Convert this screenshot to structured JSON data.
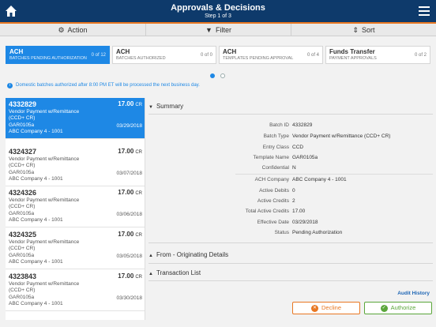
{
  "header": {
    "title": "Approvals & Decisions",
    "subtitle": "Step 1 of 3"
  },
  "toolbar": {
    "action": "Action",
    "filter": "Filter",
    "sort": "Sort"
  },
  "tiles": [
    {
      "title": "ACH",
      "subtitle": "BATCHES PENDING AUTHORIZATION",
      "count": "0 of 12"
    },
    {
      "title": "ACH",
      "subtitle": "BATCHES AUTHORIZED",
      "count": "0 of 0"
    },
    {
      "title": "ACH",
      "subtitle": "TEMPLATES PENDING APPROVAL",
      "count": "0 of 4"
    },
    {
      "title": "Funds Transfer",
      "subtitle": "PAYMENT APPROVALS",
      "count": "0 of 2"
    }
  ],
  "notice": "Domestic batches authorized after 8:00 PM ET will be processed the next business day.",
  "batches": [
    {
      "id": "4332829",
      "amount": "17.00",
      "cr": "CR",
      "desc": "Vendor Payment w/Remittance (CCD+ CR)",
      "code": "GAR0105a",
      "company": "ABC Company 4 - 1001",
      "date": "03/29/2018"
    },
    {
      "id": "4324327",
      "amount": "17.00",
      "cr": "CR",
      "desc": "Vendor Payment w/Remittance (CCD+ CR)",
      "code": "GAR0105a",
      "company": "ABC Company 4 - 1001",
      "date": "03/07/2018"
    },
    {
      "id": "4324326",
      "amount": "17.00",
      "cr": "CR",
      "desc": "Vendor Payment w/Remittance (CCD+ CR)",
      "code": "GAR0105a",
      "company": "ABC Company 4 - 1001",
      "date": "03/06/2018"
    },
    {
      "id": "4324325",
      "amount": "17.00",
      "cr": "CR",
      "desc": "Vendor Payment w/Remittance (CCD+ CR)",
      "code": "GAR0105a",
      "company": "ABC Company 4 - 1001",
      "date": "03/05/2018"
    },
    {
      "id": "4323843",
      "amount": "17.00",
      "cr": "CR",
      "desc": "Vendor Payment w/Remittance (CCD+ CR)",
      "code": "GAR0105a",
      "company": "ABC Company 4 - 1001",
      "date": "03/30/2018"
    }
  ],
  "summary": {
    "heading": "Summary",
    "fields": [
      {
        "label": "Batch ID",
        "value": "4332829"
      },
      {
        "label": "Batch Type",
        "value": "Vendor Payment w/Remittance (CCD+ CR)"
      },
      {
        "label": "Entry Class",
        "value": "CCD"
      },
      {
        "label": "Template Name",
        "value": "GAR0105a"
      },
      {
        "label": "Confidential",
        "value": "N"
      },
      {
        "label": "ACH Company",
        "value": "ABC Company 4 - 1001"
      },
      {
        "label": "Active Debits",
        "value": "0"
      },
      {
        "label": "Active Credits",
        "value": "2"
      },
      {
        "label": "Total Active Credits",
        "value": "17.00"
      },
      {
        "label": "Effective Date",
        "value": "03/29/2018"
      },
      {
        "label": "Status",
        "value": "Pending Authorization"
      }
    ]
  },
  "sections": {
    "originating": "From - Originating Details",
    "transactions": "Transaction List"
  },
  "actions": {
    "audit": "Audit History",
    "decline": "Decline",
    "authorize": "Authorize"
  },
  "icons": {
    "home": "home-icon",
    "menu": "hamburger-icon",
    "action": "gear-icon",
    "filter": "filter-icon",
    "sort": "sort-icon",
    "info": "info-icon",
    "decline": "x-circle-icon",
    "authorize": "check-circle-icon"
  },
  "colors": {
    "header": "#0e3a6b",
    "accent": "#1e88e5",
    "orange": "#e87722",
    "green": "#5aa63a"
  }
}
